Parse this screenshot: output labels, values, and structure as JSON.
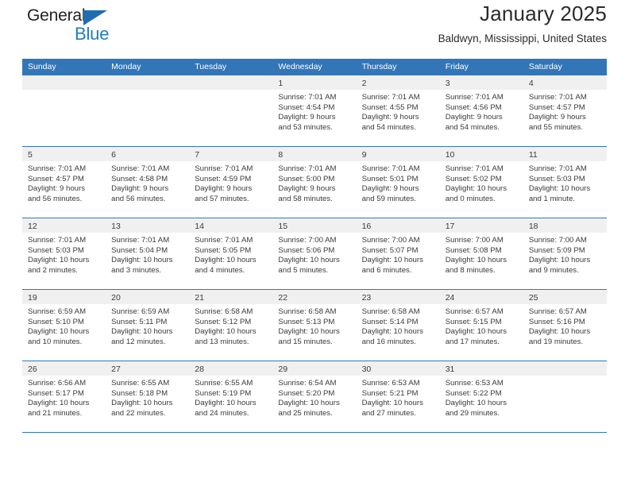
{
  "brand": {
    "name_top": "General",
    "name_bottom": "Blue",
    "accent_color": "#1f7cc4",
    "triangle_color": "#1f6cb4"
  },
  "header": {
    "title": "January 2025",
    "subtitle": "Baldwyn, Mississippi, United States"
  },
  "theme": {
    "header_row_bg": "#3276b8",
    "header_row_text": "#ffffff",
    "day_banner_bg": "#f0f0f0",
    "cell_bg": "#ffffff",
    "row_divider": "#3276b8",
    "body_text": "#3a3a3a"
  },
  "weekdays": [
    "Sunday",
    "Monday",
    "Tuesday",
    "Wednesday",
    "Thursday",
    "Friday",
    "Saturday"
  ],
  "weeks": [
    [
      {
        "day": "",
        "lines": []
      },
      {
        "day": "",
        "lines": []
      },
      {
        "day": "",
        "lines": []
      },
      {
        "day": "1",
        "lines": [
          "Sunrise: 7:01 AM",
          "Sunset: 4:54 PM",
          "Daylight: 9 hours",
          "and 53 minutes."
        ]
      },
      {
        "day": "2",
        "lines": [
          "Sunrise: 7:01 AM",
          "Sunset: 4:55 PM",
          "Daylight: 9 hours",
          "and 54 minutes."
        ]
      },
      {
        "day": "3",
        "lines": [
          "Sunrise: 7:01 AM",
          "Sunset: 4:56 PM",
          "Daylight: 9 hours",
          "and 54 minutes."
        ]
      },
      {
        "day": "4",
        "lines": [
          "Sunrise: 7:01 AM",
          "Sunset: 4:57 PM",
          "Daylight: 9 hours",
          "and 55 minutes."
        ]
      }
    ],
    [
      {
        "day": "5",
        "lines": [
          "Sunrise: 7:01 AM",
          "Sunset: 4:57 PM",
          "Daylight: 9 hours",
          "and 56 minutes."
        ]
      },
      {
        "day": "6",
        "lines": [
          "Sunrise: 7:01 AM",
          "Sunset: 4:58 PM",
          "Daylight: 9 hours",
          "and 56 minutes."
        ]
      },
      {
        "day": "7",
        "lines": [
          "Sunrise: 7:01 AM",
          "Sunset: 4:59 PM",
          "Daylight: 9 hours",
          "and 57 minutes."
        ]
      },
      {
        "day": "8",
        "lines": [
          "Sunrise: 7:01 AM",
          "Sunset: 5:00 PM",
          "Daylight: 9 hours",
          "and 58 minutes."
        ]
      },
      {
        "day": "9",
        "lines": [
          "Sunrise: 7:01 AM",
          "Sunset: 5:01 PM",
          "Daylight: 9 hours",
          "and 59 minutes."
        ]
      },
      {
        "day": "10",
        "lines": [
          "Sunrise: 7:01 AM",
          "Sunset: 5:02 PM",
          "Daylight: 10 hours",
          "and 0 minutes."
        ]
      },
      {
        "day": "11",
        "lines": [
          "Sunrise: 7:01 AM",
          "Sunset: 5:03 PM",
          "Daylight: 10 hours",
          "and 1 minute."
        ]
      }
    ],
    [
      {
        "day": "12",
        "lines": [
          "Sunrise: 7:01 AM",
          "Sunset: 5:03 PM",
          "Daylight: 10 hours",
          "and 2 minutes."
        ]
      },
      {
        "day": "13",
        "lines": [
          "Sunrise: 7:01 AM",
          "Sunset: 5:04 PM",
          "Daylight: 10 hours",
          "and 3 minutes."
        ]
      },
      {
        "day": "14",
        "lines": [
          "Sunrise: 7:01 AM",
          "Sunset: 5:05 PM",
          "Daylight: 10 hours",
          "and 4 minutes."
        ]
      },
      {
        "day": "15",
        "lines": [
          "Sunrise: 7:00 AM",
          "Sunset: 5:06 PM",
          "Daylight: 10 hours",
          "and 5 minutes."
        ]
      },
      {
        "day": "16",
        "lines": [
          "Sunrise: 7:00 AM",
          "Sunset: 5:07 PM",
          "Daylight: 10 hours",
          "and 6 minutes."
        ]
      },
      {
        "day": "17",
        "lines": [
          "Sunrise: 7:00 AM",
          "Sunset: 5:08 PM",
          "Daylight: 10 hours",
          "and 8 minutes."
        ]
      },
      {
        "day": "18",
        "lines": [
          "Sunrise: 7:00 AM",
          "Sunset: 5:09 PM",
          "Daylight: 10 hours",
          "and 9 minutes."
        ]
      }
    ],
    [
      {
        "day": "19",
        "lines": [
          "Sunrise: 6:59 AM",
          "Sunset: 5:10 PM",
          "Daylight: 10 hours",
          "and 10 minutes."
        ]
      },
      {
        "day": "20",
        "lines": [
          "Sunrise: 6:59 AM",
          "Sunset: 5:11 PM",
          "Daylight: 10 hours",
          "and 12 minutes."
        ]
      },
      {
        "day": "21",
        "lines": [
          "Sunrise: 6:58 AM",
          "Sunset: 5:12 PM",
          "Daylight: 10 hours",
          "and 13 minutes."
        ]
      },
      {
        "day": "22",
        "lines": [
          "Sunrise: 6:58 AM",
          "Sunset: 5:13 PM",
          "Daylight: 10 hours",
          "and 15 minutes."
        ]
      },
      {
        "day": "23",
        "lines": [
          "Sunrise: 6:58 AM",
          "Sunset: 5:14 PM",
          "Daylight: 10 hours",
          "and 16 minutes."
        ]
      },
      {
        "day": "24",
        "lines": [
          "Sunrise: 6:57 AM",
          "Sunset: 5:15 PM",
          "Daylight: 10 hours",
          "and 17 minutes."
        ]
      },
      {
        "day": "25",
        "lines": [
          "Sunrise: 6:57 AM",
          "Sunset: 5:16 PM",
          "Daylight: 10 hours",
          "and 19 minutes."
        ]
      }
    ],
    [
      {
        "day": "26",
        "lines": [
          "Sunrise: 6:56 AM",
          "Sunset: 5:17 PM",
          "Daylight: 10 hours",
          "and 21 minutes."
        ]
      },
      {
        "day": "27",
        "lines": [
          "Sunrise: 6:55 AM",
          "Sunset: 5:18 PM",
          "Daylight: 10 hours",
          "and 22 minutes."
        ]
      },
      {
        "day": "28",
        "lines": [
          "Sunrise: 6:55 AM",
          "Sunset: 5:19 PM",
          "Daylight: 10 hours",
          "and 24 minutes."
        ]
      },
      {
        "day": "29",
        "lines": [
          "Sunrise: 6:54 AM",
          "Sunset: 5:20 PM",
          "Daylight: 10 hours",
          "and 25 minutes."
        ]
      },
      {
        "day": "30",
        "lines": [
          "Sunrise: 6:53 AM",
          "Sunset: 5:21 PM",
          "Daylight: 10 hours",
          "and 27 minutes."
        ]
      },
      {
        "day": "31",
        "lines": [
          "Sunrise: 6:53 AM",
          "Sunset: 5:22 PM",
          "Daylight: 10 hours",
          "and 29 minutes."
        ]
      },
      {
        "day": "",
        "lines": []
      }
    ]
  ]
}
